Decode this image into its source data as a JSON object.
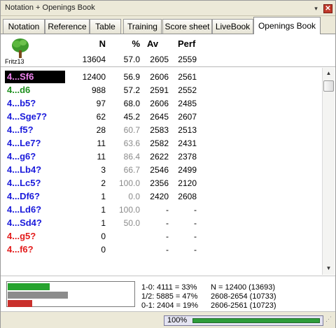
{
  "window": {
    "title": "Notation + Openings Book",
    "pin_glyph": "▾",
    "close_glyph": "✕"
  },
  "tabs": [
    {
      "label": "Notation",
      "active": false
    },
    {
      "label": "Reference",
      "active": false
    },
    {
      "label": "Table",
      "active": false
    },
    {
      "label": "Training",
      "active": false
    },
    {
      "label": "Score sheet",
      "active": false
    },
    {
      "label": "LiveBook",
      "active": false
    },
    {
      "label": "Openings Book",
      "active": true
    }
  ],
  "book": {
    "engine_label": "Fritz13",
    "engine_icon": "tree-icon",
    "headers": {
      "n": "N",
      "pct": "%",
      "av": "Av",
      "perf": "Perf"
    },
    "totals": {
      "n": "13604",
      "pct": "57.0",
      "av": "2605",
      "perf": "2559"
    }
  },
  "moves": [
    {
      "move": "4...Sf6",
      "n": "12400",
      "pct": "56.9",
      "av": "2606",
      "perf": "2561",
      "color": "#ee82ee",
      "pct_grey": false,
      "selected": true
    },
    {
      "move": "4...d6",
      "n": "988",
      "pct": "57.2",
      "av": "2591",
      "perf": "2552",
      "color": "#1e8f1e",
      "pct_grey": false,
      "selected": false
    },
    {
      "move": "4...b5?",
      "n": "97",
      "pct": "68.0",
      "av": "2606",
      "perf": "2485",
      "color": "#1a1adb",
      "pct_grey": false,
      "selected": false
    },
    {
      "move": "4...Sge7?",
      "n": "62",
      "pct": "45.2",
      "av": "2645",
      "perf": "2607",
      "color": "#1a1adb",
      "pct_grey": false,
      "selected": false
    },
    {
      "move": "4...f5?",
      "n": "28",
      "pct": "60.7",
      "av": "2583",
      "perf": "2513",
      "color": "#1a1adb",
      "pct_grey": true,
      "selected": false
    },
    {
      "move": "4...Le7?",
      "n": "11",
      "pct": "63.6",
      "av": "2582",
      "perf": "2431",
      "color": "#1a1adb",
      "pct_grey": true,
      "selected": false
    },
    {
      "move": "4...g6?",
      "n": "11",
      "pct": "86.4",
      "av": "2622",
      "perf": "2378",
      "color": "#1a1adb",
      "pct_grey": true,
      "selected": false
    },
    {
      "move": "4...Lb4?",
      "n": "3",
      "pct": "66.7",
      "av": "2546",
      "perf": "2499",
      "color": "#1a1adb",
      "pct_grey": true,
      "selected": false
    },
    {
      "move": "4...Lc5?",
      "n": "2",
      "pct": "100.0",
      "av": "2356",
      "perf": "2120",
      "color": "#1a1adb",
      "pct_grey": true,
      "selected": false
    },
    {
      "move": "4...Df6?",
      "n": "1",
      "pct": "0.0",
      "av": "2420",
      "perf": "2608",
      "color": "#1a1adb",
      "pct_grey": true,
      "selected": false
    },
    {
      "move": "4...Ld6?",
      "n": "1",
      "pct": "100.0",
      "av": "-",
      "perf": "-",
      "color": "#1a1adb",
      "pct_grey": true,
      "selected": false
    },
    {
      "move": "4...Sd4?",
      "n": "1",
      "pct": "50.0",
      "av": "-",
      "perf": "-",
      "color": "#1a1adb",
      "pct_grey": true,
      "selected": false
    },
    {
      "move": "4...g5?",
      "n": "0",
      "pct": "",
      "av": "-",
      "perf": "-",
      "color": "#e31b1b",
      "pct_grey": false,
      "selected": false
    },
    {
      "move": "4...f6?",
      "n": "0",
      "pct": "",
      "av": "-",
      "perf": "-",
      "color": "#e31b1b",
      "pct_grey": false,
      "selected": false
    }
  ],
  "stats": {
    "bars": [
      {
        "name": "white-wins-bar",
        "fraction": 0.33,
        "color": "#27a32f"
      },
      {
        "name": "draws-bar",
        "fraction": 0.47,
        "color": "#8c8c8c"
      },
      {
        "name": "black-wins-bar",
        "fraction": 0.19,
        "color": "#c9302c"
      }
    ],
    "line1": "1-0: 4111 = 33%",
    "line2": "1/2: 5885 = 47%",
    "line3": "0-1: 2404 = 19%",
    "right1": "N = 12400 (13693)",
    "right2": "2608-2654 (10733)",
    "right3": "2606-2561 (10723)"
  },
  "status": {
    "zoom": "100%",
    "progress": 1.0
  }
}
